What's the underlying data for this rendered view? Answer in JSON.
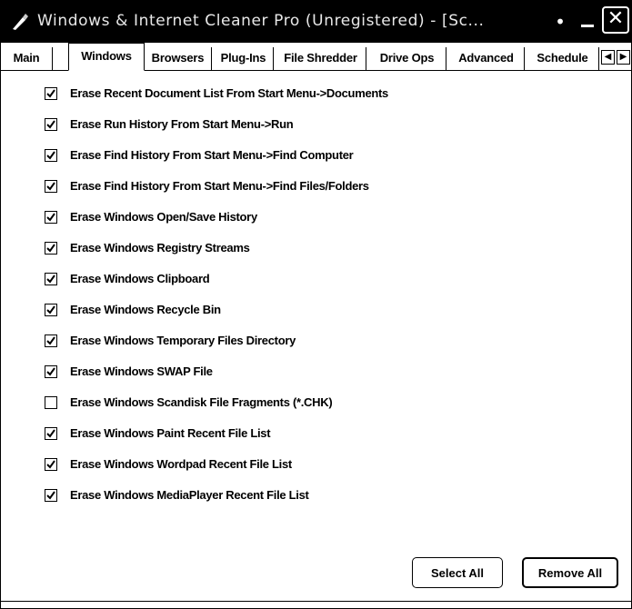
{
  "window": {
    "title": "Windows & Internet Cleaner Pro (Unregistered) - [Sc...",
    "title_icon": "app-icon",
    "controls": {
      "help_icon": "help-dot-icon",
      "minimize_icon": "minimize-icon",
      "close_glyph": "✕"
    }
  },
  "tabs": [
    {
      "label": "Main"
    },
    {
      "label": "Windows"
    },
    {
      "label": "Browsers"
    },
    {
      "label": "Plug-Ins"
    },
    {
      "label": "File Shredder"
    },
    {
      "label": "Drive Ops"
    },
    {
      "label": "Advanced"
    },
    {
      "label": "Schedule"
    }
  ],
  "active_tab": "Windows",
  "tab_scroll": {
    "left": "◀",
    "right": "▶"
  },
  "options": [
    {
      "label": "Erase Recent Document List From Start Menu->Documents",
      "checked": true
    },
    {
      "label": "Erase Run History From Start Menu->Run",
      "checked": true
    },
    {
      "label": "Erase Find History From Start Menu->Find Computer",
      "checked": true
    },
    {
      "label": "Erase Find History From Start Menu->Find Files/Folders",
      "checked": true
    },
    {
      "label": "Erase Windows Open/Save History",
      "checked": true
    },
    {
      "label": "Erase Windows Registry Streams",
      "checked": true
    },
    {
      "label": "Erase Windows Clipboard",
      "checked": true
    },
    {
      "label": "Erase Windows Recycle Bin",
      "checked": true
    },
    {
      "label": "Erase Windows Temporary Files Directory",
      "checked": true
    },
    {
      "label": "Erase Windows SWAP File",
      "checked": true
    },
    {
      "label": "Erase Windows Scandisk File Fragments (*.CHK)",
      "checked": false
    },
    {
      "label": "Erase Windows Paint Recent File List",
      "checked": true
    },
    {
      "label": "Erase Windows Wordpad Recent File List",
      "checked": true
    },
    {
      "label": "Erase Windows MediaPlayer Recent File List",
      "checked": true
    }
  ],
  "buttons": {
    "select_all": "Select All",
    "remove_all": "Remove All"
  }
}
